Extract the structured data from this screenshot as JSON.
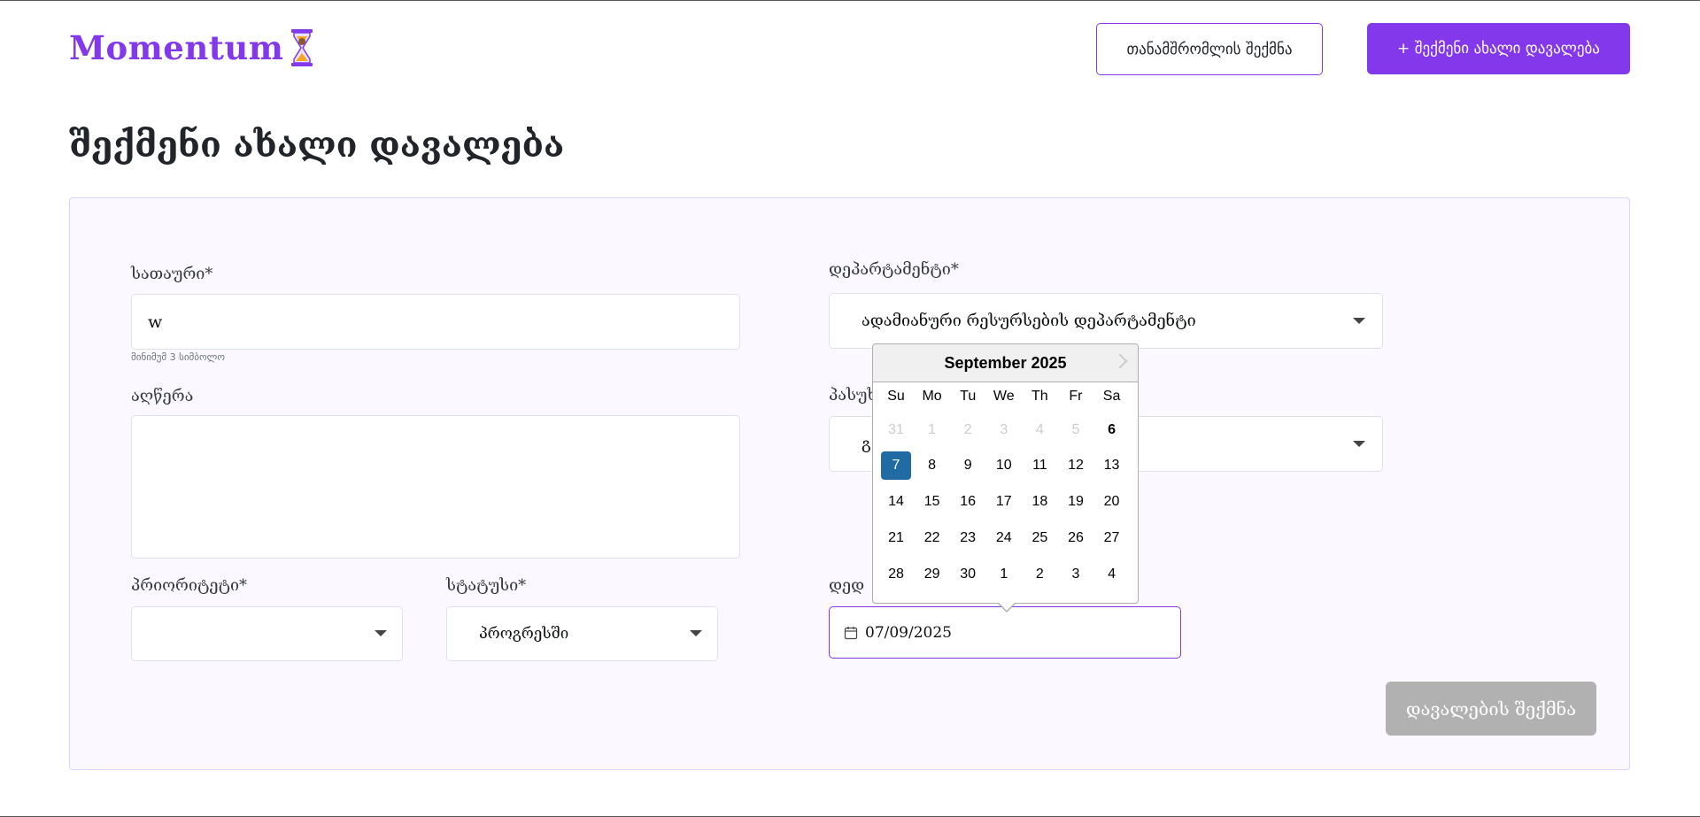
{
  "header": {
    "logo_text": "Momentum",
    "logo_icon": "hourglass-icon",
    "create_employee_label": "თანამშრომლის შექმნა",
    "create_task_label": "+ შექმენი ახალი დავალება",
    "accent_color": "#8338EC"
  },
  "page": {
    "title": "შექმენი ახალი დავალება"
  },
  "form": {
    "title_label": "სათაური*",
    "title_value": "w",
    "title_hint": "მინიმუმ 3 სიმბოლო",
    "description_label": "აღწერა",
    "description_value": "",
    "priority_label": "პრიორიტეტი*",
    "priority_value": "",
    "status_label": "სტატუსი*",
    "status_value": "პროგრესში",
    "department_label": "დეპარტამენტი*",
    "department_value": "ადამიანური რესურსების დეპარტამენტი",
    "responsible_label": "პასუხ",
    "responsible_value": "გ",
    "deadline_label": "დედ",
    "deadline_value": "07/09/2025",
    "submit_label": "დავალების შექმნა"
  },
  "datepicker": {
    "month": "September 2025",
    "day_names": [
      "Su",
      "Mo",
      "Tu",
      "We",
      "Th",
      "Fr",
      "Sa"
    ],
    "weeks": [
      [
        "31",
        "1",
        "2",
        "3",
        "4",
        "5",
        "6"
      ],
      [
        "7",
        "8",
        "9",
        "10",
        "11",
        "12",
        "13"
      ],
      [
        "14",
        "15",
        "16",
        "17",
        "18",
        "19",
        "20"
      ],
      [
        "21",
        "22",
        "23",
        "24",
        "25",
        "26",
        "27"
      ],
      [
        "28",
        "29",
        "30",
        "1",
        "2",
        "3",
        "4"
      ]
    ],
    "selected_day": "7",
    "today": "6",
    "selected_color": "#216ba5"
  }
}
